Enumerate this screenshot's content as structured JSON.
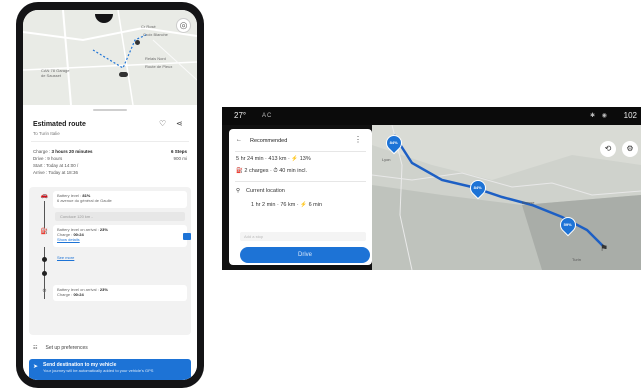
{
  "phone": {
    "map": {
      "labels": [
        "Cr Rosé",
        "Croix Blanche",
        "CAN 78 Garage de Sausset",
        "Relais Nord",
        "Route de Pleux"
      ]
    },
    "route": {
      "title": "Estimated route",
      "subtitle": "To Turin Italie",
      "rows": [
        {
          "label": "Charge : ",
          "value": "3 hours 20 minutes",
          "right": "6 Steps"
        },
        {
          "label": "Drive : 9 hours",
          "value": "",
          "right": "900 mi"
        },
        {
          "label": "Start : Today at 14:00 /",
          "value": "",
          "right": ""
        },
        {
          "label": "Arrive : Today at 18:36",
          "value": "",
          "right": ""
        }
      ]
    },
    "steps": {
      "s1_battery_label": "Battery level : ",
      "s1_battery_value": "81%",
      "s1_address": "6 avenue du général de Gaulle",
      "conduce": "Conduce 120 km -",
      "s2_arrival_label": "Battery level on arrival : ",
      "s2_arrival_value": "23%",
      "s2_charge_label": "Charge : ",
      "s2_charge_value": "00:24",
      "s2_details": "Show details",
      "see_more": "See more",
      "s3_arrival_label": "Battery level on arrival : ",
      "s3_arrival_value": "23%",
      "s3_charge_label": "Charge : ",
      "s3_charge_value": "00:24"
    },
    "prefs_label": "Set up preferences",
    "banner": {
      "title": "Send destination to my vehicle",
      "subtitle": "Your journey will be automatically added to your vehicle's GPS"
    }
  },
  "car": {
    "status": {
      "temp": "27°",
      "ac": "AC",
      "right": "102"
    },
    "panel": {
      "header": "Recommended",
      "summary": "5 hr 24 min · 413 km · ⚡ 13%",
      "charges": "⛽ 2 charges · ⏱ 40 min incl.",
      "location": "Current location",
      "leg": "1 hr 2 min · 76 km · ⚡ 6 min",
      "input_placeholder": "Add a stop",
      "drive_label": "Drive"
    },
    "map": {
      "pois": [
        "84%",
        "84%",
        "59%"
      ],
      "labels": [
        "Lyon",
        "Bresse",
        "Turin"
      ]
    },
    "accent": "#1d73d6"
  }
}
